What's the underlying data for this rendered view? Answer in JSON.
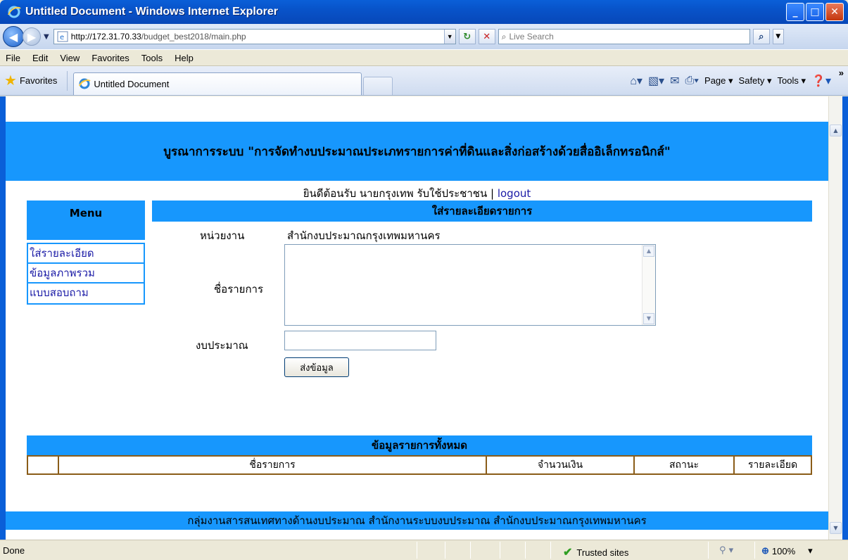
{
  "window": {
    "title": "Untitled Document - Windows Internet Explorer",
    "minimize": "_",
    "maximize": "□",
    "close": "✕"
  },
  "address": {
    "url_host": "http://172.31.70.33",
    "url_path": "/budget_best2018/main.php",
    "search_placeholder": "Live Search"
  },
  "menubar": {
    "items": [
      "File",
      "Edit",
      "View",
      "Favorites",
      "Tools",
      "Help"
    ]
  },
  "tabs": {
    "favorites_label": "Favorites",
    "active_tab": "Untitled Document"
  },
  "commandbar": {
    "page": "Page",
    "safety": "Safety",
    "tools": "Tools"
  },
  "page": {
    "header_title": "บูรณาการระบบ \"การจัดทำงบประมาณประเภทรายการค่าที่ดินและสิ่งก่อสร้างด้วยสื่ออิเล็กทรอนิกส์\"",
    "welcome_text": "ยินดีต้อนรับ นายกรุงเทพ รับใช้ประชาชน | ",
    "logout_label": "logout",
    "menu_title": "Menu",
    "menu_items": [
      "ใส่รายละเอียด",
      "ข้อมูลภาพรวม",
      "แบบสอบถาม"
    ],
    "form_title": "ใส่รายละเอียดรายการ",
    "dept_label": "หน่วยงาน",
    "dept_value": "สำนักงบประมาณกรุงเทพมหานคร",
    "name_label": "ชื่อรายการ",
    "budget_label": "งบประมาณ",
    "submit_label": "ส่งข้อมูล",
    "table_title": "ข้อมูลรายการทั้งหมด",
    "table_headers": [
      "",
      "ชื่อรายการ",
      "จำนวนเงิน",
      "สถานะ",
      "รายละเอียด"
    ],
    "footer_text": "กลุ่มงานสารสนเทศทางด้านงบประมาณ สำนักงานระบบงบประมาณ สำนักงบประมาณกรุงเทพมหานคร"
  },
  "status": {
    "text": "Done",
    "zone": "Trusted sites",
    "zoom": "100%"
  },
  "colors": {
    "band_blue": "#1797fd",
    "table_border": "#8a5c18",
    "link_blue": "#1a1aa6"
  }
}
